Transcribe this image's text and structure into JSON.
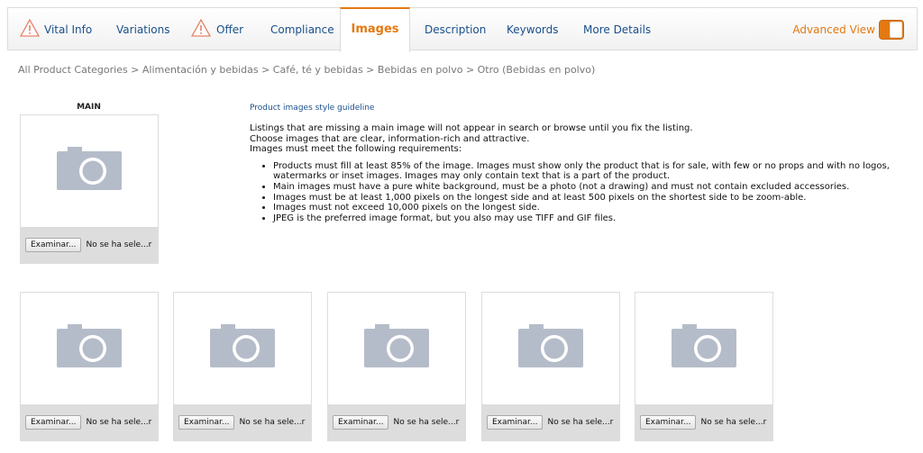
{
  "tabs": [
    {
      "label": "Vital Info",
      "warning": true,
      "active": false
    },
    {
      "label": "Variations",
      "warning": false,
      "active": false
    },
    {
      "label": "Offer",
      "warning": true,
      "active": false
    },
    {
      "label": "Compliance",
      "warning": false,
      "active": false
    },
    {
      "label": "Images",
      "warning": false,
      "active": true
    },
    {
      "label": "Description",
      "warning": false,
      "active": false
    },
    {
      "label": "Keywords",
      "warning": false,
      "active": false
    },
    {
      "label": "More Details",
      "warning": false,
      "active": false
    }
  ],
  "advanced_view": {
    "label": "Advanced View",
    "enabled": true
  },
  "breadcrumb": "All Product Categories > Alimentación y bebidas > Café, té y bebidas > Bebidas en polvo > Otro (Bebidas en polvo)",
  "main_image": {
    "title": "MAIN"
  },
  "file_input": {
    "button": "Examinar...",
    "status": "No se ha sele...r"
  },
  "guideline": {
    "link": "Product images style guideline",
    "intro": [
      "Listings that are missing a main image will not appear in search or browse until you fix the listing.",
      "Choose images that are clear, information-rich and attractive.",
      "Images must meet the following requirements:"
    ],
    "requirements": [
      "Products must fill at least 85% of the image. Images must show only the product that is for sale, with few or no props and with no logos, watermarks or inset images. Images may only contain text that is a part of the product.",
      "Main images must have a pure white background, must be a photo (not a drawing) and must not contain excluded accessories.",
      "Images must be at least 1,000 pixels on the longest side and at least 500 pixels on the shortest side to be zoom-able.",
      "Images must not exceed 10,000 pixels on the longest side.",
      "JPEG is the preferred image format, but you also may use TIFF and GIF files."
    ]
  },
  "colors": {
    "accent": "#e47911",
    "link": "#1a4f8b",
    "camera": "#b5bcc9"
  }
}
